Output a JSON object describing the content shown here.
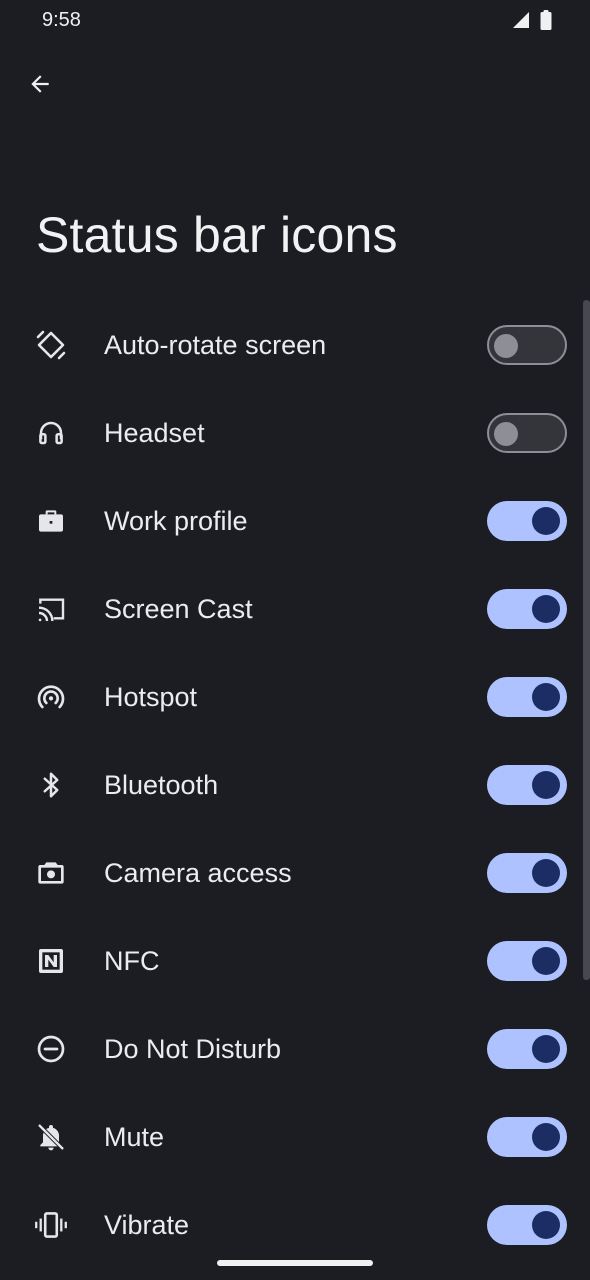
{
  "status_bar": {
    "time": "9:58",
    "icons": [
      "signal-icon",
      "battery-icon"
    ]
  },
  "header": {
    "back_icon": "arrow-back-icon",
    "title": "Status bar icons"
  },
  "items": [
    {
      "label": "Auto-rotate screen",
      "icon": "auto-rotate-icon",
      "enabled": false
    },
    {
      "label": "Headset",
      "icon": "headset-icon",
      "enabled": false
    },
    {
      "label": "Work profile",
      "icon": "briefcase-icon",
      "enabled": true
    },
    {
      "label": "Screen Cast",
      "icon": "cast-icon",
      "enabled": true
    },
    {
      "label": "Hotspot",
      "icon": "hotspot-icon",
      "enabled": true
    },
    {
      "label": "Bluetooth",
      "icon": "bluetooth-icon",
      "enabled": true
    },
    {
      "label": "Camera access",
      "icon": "camera-icon",
      "enabled": true
    },
    {
      "label": "NFC",
      "icon": "nfc-icon",
      "enabled": true
    },
    {
      "label": "Do Not Disturb",
      "icon": "do-not-disturb-icon",
      "enabled": true
    },
    {
      "label": "Mute",
      "icon": "bell-off-icon",
      "enabled": true
    },
    {
      "label": "Vibrate",
      "icon": "vibrate-icon",
      "enabled": true
    }
  ],
  "colors": {
    "background": "#1c1d22",
    "text": "#ececf0",
    "toggle_on_track": "#aec2ff",
    "toggle_on_thumb": "#1b2d63",
    "toggle_off_track": "#34353b",
    "toggle_off_outline": "#8e8f96"
  }
}
